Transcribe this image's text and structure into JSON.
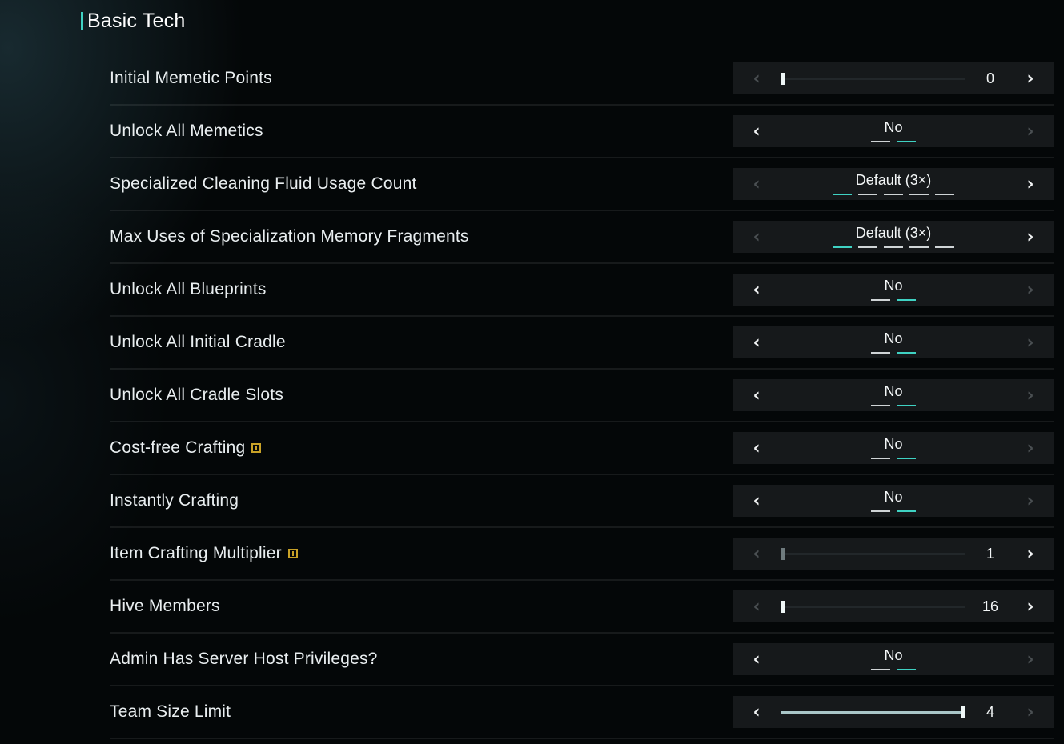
{
  "section": {
    "title": "Basic Tech"
  },
  "rows": [
    {
      "label": "Initial Memetic Points",
      "type": "slider",
      "value": "0",
      "fraction": 0.0,
      "left_enabled": false,
      "right_enabled": true
    },
    {
      "label": "Unlock All Memetics",
      "type": "select",
      "value": "No",
      "options_count": 2,
      "selected_index": 1,
      "left_enabled": true,
      "right_enabled": false
    },
    {
      "label": "Specialized Cleaning Fluid Usage Count",
      "type": "select",
      "value": "Default (3×)",
      "options_count": 5,
      "selected_index": 0,
      "left_enabled": false,
      "right_enabled": true
    },
    {
      "label": "Max Uses of Specialization Memory Fragments",
      "type": "select",
      "value": "Default (3×)",
      "options_count": 5,
      "selected_index": 0,
      "left_enabled": false,
      "right_enabled": true
    },
    {
      "label": "Unlock All Blueprints",
      "type": "select",
      "value": "No",
      "options_count": 2,
      "selected_index": 1,
      "left_enabled": true,
      "right_enabled": false
    },
    {
      "label": "Unlock All Initial Cradle",
      "type": "select",
      "value": "No",
      "options_count": 2,
      "selected_index": 1,
      "left_enabled": true,
      "right_enabled": false
    },
    {
      "label": "Unlock All Cradle Slots",
      "type": "select",
      "value": "No",
      "options_count": 2,
      "selected_index": 1,
      "left_enabled": true,
      "right_enabled": false
    },
    {
      "label": "Cost-free Crafting",
      "info": true,
      "type": "select",
      "value": "No",
      "options_count": 2,
      "selected_index": 1,
      "left_enabled": true,
      "right_enabled": false
    },
    {
      "label": "Instantly Crafting",
      "type": "select",
      "value": "No",
      "options_count": 2,
      "selected_index": 1,
      "left_enabled": true,
      "right_enabled": false
    },
    {
      "label": "Item Crafting Multiplier",
      "info": true,
      "type": "slider",
      "value": "1",
      "fraction": 0.0,
      "thumb_dim": true,
      "left_enabled": false,
      "right_enabled": true
    },
    {
      "label": "Hive Members",
      "type": "slider",
      "value": "16",
      "fraction": 0.0,
      "left_enabled": false,
      "right_enabled": true
    },
    {
      "label": "Admin Has Server Host Privileges?",
      "type": "select",
      "value": "No",
      "options_count": 2,
      "selected_index": 1,
      "left_enabled": true,
      "right_enabled": false
    },
    {
      "label": "Team Size Limit",
      "type": "slider",
      "value": "4",
      "fraction": 1.0,
      "left_enabled": true,
      "right_enabled": false
    }
  ],
  "colors": {
    "accent": "#3fd2c3",
    "info": "#c9a227",
    "control_bg": "#16191b"
  },
  "icons": {
    "left": "chevron-left-icon",
    "right": "chevron-right-icon",
    "info": "info-icon"
  }
}
